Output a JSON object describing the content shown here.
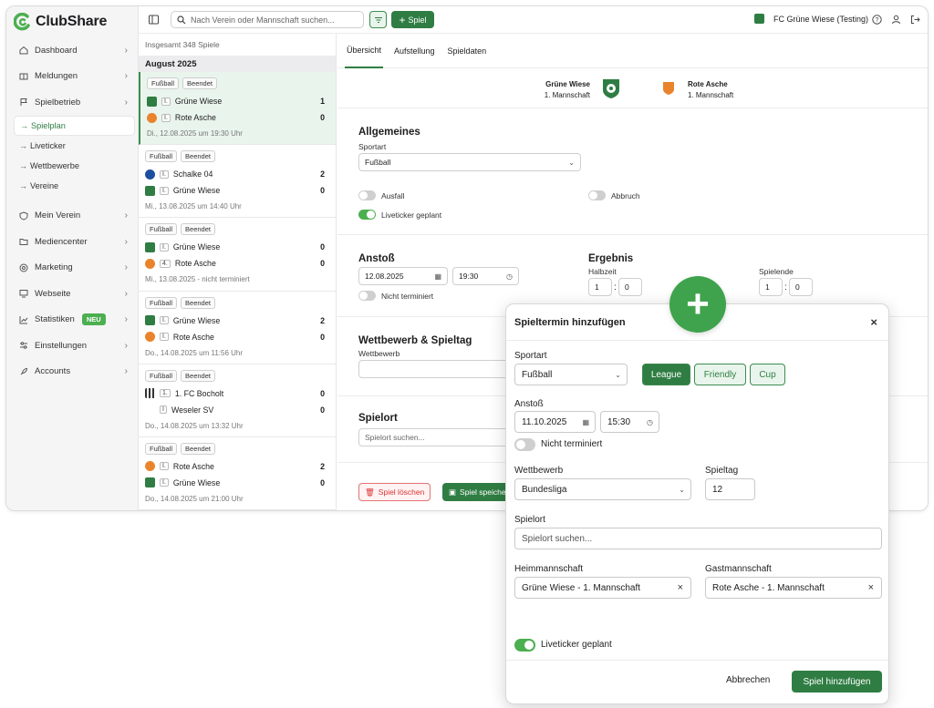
{
  "app": {
    "name": "ClubShare"
  },
  "sidebar": {
    "items": [
      {
        "label": "Dashboard"
      },
      {
        "label": "Meldungen"
      },
      {
        "label": "Spielbetrieb"
      },
      {
        "label": "Mein Verein"
      },
      {
        "label": "Mediencenter"
      },
      {
        "label": "Marketing"
      },
      {
        "label": "Webseite"
      },
      {
        "label": "Statistiken",
        "badge": "NEU"
      },
      {
        "label": "Einstellungen"
      },
      {
        "label": "Accounts"
      }
    ],
    "subitems": [
      {
        "label": "Spielplan"
      },
      {
        "label": "Liveticker"
      },
      {
        "label": "Wettbewerbe"
      },
      {
        "label": "Vereine"
      }
    ]
  },
  "topbar": {
    "search_placeholder": "Nach Verein oder Mannschaft suchen...",
    "add_label": "Spiel",
    "club": "FC Grüne Wiese (Testing)"
  },
  "list": {
    "total": "Insgesamt 348 Spiele",
    "month": "August 2025",
    "matches": [
      {
        "tags": [
          "Fußball",
          "Beendet"
        ],
        "home": {
          "lvl": "I.",
          "name": "Grüne Wiese",
          "score": "1"
        },
        "away": {
          "lvl": "I.",
          "name": "Rote Asche",
          "score": "0"
        },
        "date": "Di., 12.08.2025 um 19:30 Uhr"
      },
      {
        "tags": [
          "Fußball",
          "Beendet"
        ],
        "home": {
          "lvl": "I.",
          "name": "Schalke 04",
          "score": "2"
        },
        "away": {
          "lvl": "I.",
          "name": "Grüne Wiese",
          "score": "0"
        },
        "date": "Mi., 13.08.2025 um 14:40 Uhr"
      },
      {
        "tags": [
          "Fußball",
          "Beendet"
        ],
        "home": {
          "lvl": "I.",
          "name": "Grüne Wiese",
          "score": "0"
        },
        "away": {
          "lvl": "4.",
          "name": "Rote Asche",
          "score": "0"
        },
        "date": "Mi., 13.08.2025 - nicht terminiert"
      },
      {
        "tags": [
          "Fußball",
          "Beendet"
        ],
        "home": {
          "lvl": "I.",
          "name": "Grüne Wiese",
          "score": "2"
        },
        "away": {
          "lvl": "I.",
          "name": "Rote Asche",
          "score": "0"
        },
        "date": "Do., 14.08.2025 um 11:56 Uhr"
      },
      {
        "tags": [
          "Fußball",
          "Beendet"
        ],
        "home": {
          "lvl": "1.",
          "name": "1. FC Bocholt",
          "score": "0"
        },
        "away": {
          "lvl": "I",
          "name": "Weseler SV",
          "score": "0"
        },
        "date": "Do., 14.08.2025 um 13:32 Uhr"
      },
      {
        "tags": [
          "Fußball",
          "Beendet"
        ],
        "home": {
          "lvl": "I.",
          "name": "Rote Asche",
          "score": "2"
        },
        "away": {
          "lvl": "I.",
          "name": "Grüne Wiese",
          "score": "0"
        },
        "date": "Do., 14.08.2025 um 21:00 Uhr"
      }
    ]
  },
  "detail": {
    "tabs": [
      "Übersicht",
      "Aufstellung",
      "Spieldaten"
    ],
    "home_team": "Grüne Wiese",
    "home_sub": "1. Mannschaft",
    "away_team": "Rote Asche",
    "away_sub": "1. Mannschaft",
    "general_title": "Allgemeines",
    "sport_label": "Sportart",
    "sport_value": "Fußball",
    "ausfall": "Ausfall",
    "abbruch": "Abbruch",
    "liveticker": "Liveticker geplant",
    "anstoss_title": "Anstoß",
    "date": "12.08.2025",
    "time": "19:30",
    "nicht_terminiert": "Nicht terminiert",
    "ergebnis_title": "Ergebnis",
    "halbzeit": "Halbzeit",
    "spielende": "Spielende",
    "hz_home": "1",
    "hz_away": "0",
    "se_home": "1",
    "se_away": "0",
    "wettbewerb_title": "Wettbewerb & Spieltag",
    "wettbewerb_label": "Wettbewerb",
    "spielort_title": "Spielort",
    "spielort_placeholder": "Spielort suchen...",
    "delete_label": "Spiel löschen",
    "save_label": "Spiel speichern"
  },
  "modal": {
    "title": "Spieltermin hinzufügen",
    "sport_label": "Sportart",
    "sport_value": "Fußball",
    "types": [
      "League",
      "Friendly",
      "Cup"
    ],
    "anstoss_label": "Anstoß",
    "date": "11.10.2025",
    "time": "15:30",
    "nicht_terminiert": "Nicht terminiert",
    "wettbewerb_label": "Wettbewerb",
    "wettbewerb_value": "Bundesliga",
    "spieltag_label": "Spieltag",
    "spieltag_value": "12",
    "spielort_label": "Spielort",
    "spielort_placeholder": "Spielort suchen...",
    "heim_label": "Heimmannschaft",
    "heim_value": "Grüne Wiese - 1. Mannschaft",
    "gast_label": "Gastmannschaft",
    "gast_value": "Rote Asche - 1. Mannschaft",
    "liveticker": "Liveticker geplant",
    "cancel": "Abbrechen",
    "submit": "Spiel hinzufügen"
  },
  "colors": {
    "primary": "#2f7d43",
    "accent": "#4caf50",
    "danger": "#d33333"
  }
}
